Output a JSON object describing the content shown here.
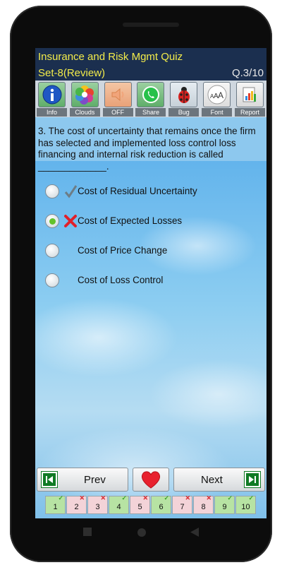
{
  "app": {
    "title": "Insurance and Risk Mgmt Quiz",
    "set_label": "Set-8(Review)",
    "question_counter": "Q.3/10"
  },
  "toolbar": [
    {
      "label": "Info",
      "icon": "info-icon"
    },
    {
      "label": "Clouds",
      "icon": "clouds-icon"
    },
    {
      "label": "OFF",
      "icon": "sound-off-icon"
    },
    {
      "label": "Share",
      "icon": "share-icon"
    },
    {
      "label": "Bug",
      "icon": "bug-icon"
    },
    {
      "label": "Font",
      "icon": "font-icon"
    },
    {
      "label": "Report",
      "icon": "report-icon"
    }
  ],
  "question": {
    "text": "3. The cost of uncertainty that remains once the firm has selected and implemented loss control loss financing and internal risk reduction is called _____________."
  },
  "options": [
    {
      "text": "Cost of Residual Uncertainty",
      "selected": false,
      "mark": "correct"
    },
    {
      "text": "Cost of Expected Losses",
      "selected": true,
      "mark": "wrong"
    },
    {
      "text": "Cost of Price Change",
      "selected": false,
      "mark": "none"
    },
    {
      "text": "Cost of Loss Control",
      "selected": false,
      "mark": "none"
    }
  ],
  "nav": {
    "prev_label": "Prev",
    "next_label": "Next"
  },
  "question_nav": [
    {
      "num": "1",
      "status": "correct"
    },
    {
      "num": "2",
      "status": "wrong"
    },
    {
      "num": "3",
      "status": "wrong"
    },
    {
      "num": "4",
      "status": "correct"
    },
    {
      "num": "5",
      "status": "wrong"
    },
    {
      "num": "6",
      "status": "correct"
    },
    {
      "num": "7",
      "status": "wrong"
    },
    {
      "num": "8",
      "status": "wrong"
    },
    {
      "num": "9",
      "status": "correct"
    },
    {
      "num": "10",
      "status": "correct"
    }
  ],
  "colors": {
    "header_bg": "#1b2f4f",
    "title_text": "#f3ec4a",
    "correct": "#3fa52c",
    "wrong": "#d9242b",
    "heart": "#e8212e"
  }
}
